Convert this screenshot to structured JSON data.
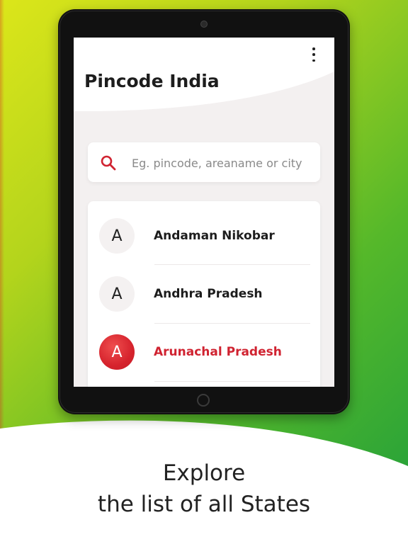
{
  "app": {
    "title": "Pincode India"
  },
  "search": {
    "placeholder": "Eg. pincode, areaname or city",
    "icon": "search-icon"
  },
  "states": [
    {
      "initial": "A",
      "name": "Andaman Nikobar",
      "selected": false
    },
    {
      "initial": "A",
      "name": "Andhra Pradesh",
      "selected": false
    },
    {
      "initial": "A",
      "name": "Arunachal Pradesh",
      "selected": true
    }
  ],
  "caption": {
    "line1": "Explore",
    "line2": "the list of all States"
  },
  "colors": {
    "accent": "#d02331",
    "gradient_start": "#dce61a",
    "gradient_end": "#1f9e3c"
  }
}
